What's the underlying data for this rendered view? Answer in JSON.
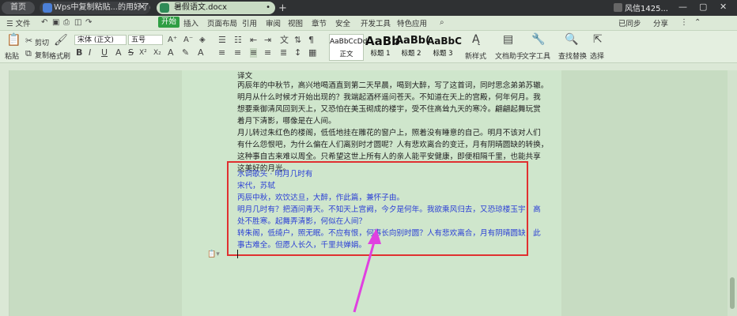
{
  "tabs": {
    "home": "首页",
    "doc1": "Wps中复制粘贴...的用好了吗（二）",
    "doc2": "暑假语文.docx",
    "new_tab": "+"
  },
  "title_bar": {
    "user_name": "风信1425..."
  },
  "menu": {
    "file": "☰ 文件",
    "start": "开始",
    "insert": "插入",
    "layout": "页面布局",
    "references": "引用",
    "review": "审阅",
    "view": "视图",
    "chapter": "章节",
    "security": "安全",
    "developer": "开发工具",
    "special": "特色应用",
    "search_icon": "search-icon",
    "uploaded": "已同步",
    "share": "分享"
  },
  "ribbon": {
    "paste": "粘贴",
    "cut": "剪切",
    "copy": "复制",
    "format_painter": "格式刷",
    "font_name": "宋体 (正文)",
    "font_size": "五号",
    "styles": [
      {
        "sample": "AaBbCcDd",
        "label": "正文"
      },
      {
        "sample": "AaBb",
        "label": "标题 1"
      },
      {
        "sample": "AaBb(",
        "label": "标题 2"
      },
      {
        "sample": "AaBbC",
        "label": "标题 3"
      }
    ],
    "new_style": "新样式",
    "doc_helper": "文档助手",
    "text_tools": "文字工具",
    "find_replace": "查找替换",
    "select": "选择"
  },
  "document": {
    "lines": [
      "译文",
      "丙辰年的中秋节，高兴地喝酒直到第二天早晨，喝到大醉，写了这首词，同时思念弟弟苏辙。",
      "明月从什么时候才开始出现的？我端起酒杯遥问苍天。不知道在天上的宫殿，何年何月。我",
      "想要乘御清风回到天上，又恐怕在美玉砌成的楼宇，受不住高耸九天的寒冷。翩翩起舞玩赏",
      "着月下清影，哪像是在人间。",
      "月儿转过朱红色的楼阁，低低地挂在雕花的窗户上，照着没有睡意的自己。明月不该对人们",
      "有什么怨恨吧，为什么偏在人们离别时才圆呢？人有悲欢离合的变迁，月有阴晴圆缺的转换，",
      "这种事自古来难以周全。只希望这世上所有人的亲人能平安健康，即便相隔千里，也能共享",
      "这美好的月光。"
    ],
    "poem": [
      "水调歌头 · 明月几时有",
      "宋代，苏轼",
      "丙辰中秋，欢饮达旦，大醉，作此篇，兼怀子由。",
      "明月几时有？把酒问青天。不知天上宫阙，今夕是何年。我欲乘风归去，又恐琼楼玉宇，高",
      "处不胜寒。起舞弄清影，何似在人间？",
      "转朱阁，低绮户，照无眠。不应有恨，何事长向别时圆？人有悲欢离合，月有阴晴圆缺，此",
      "事古难全。但愿人长久，千里共婵娟。"
    ]
  },
  "colors": {
    "accent": "#2f9e44",
    "annotation": "#e03030",
    "arrow": "#e040e0",
    "poem_text": "#2b3fd6"
  }
}
